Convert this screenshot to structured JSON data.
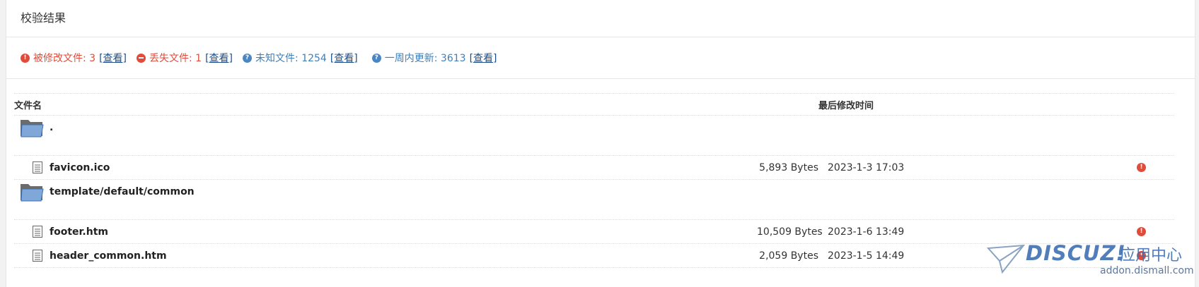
{
  "panel": {
    "title": "校验结果"
  },
  "summary": [
    {
      "label": "被修改文件: 3",
      "link": "[查看]",
      "tone": "red",
      "icon": "warning-icon"
    },
    {
      "label": "丢失文件: 1",
      "link": "[查看]",
      "tone": "red",
      "icon": "minus-circle-icon"
    },
    {
      "label": "未知文件: 1254",
      "link": "[查看]",
      "tone": "blue",
      "icon": "question-icon"
    },
    {
      "label": "一周内更新: 3613",
      "link": "[查看]",
      "tone": "blue",
      "icon": "question-icon"
    }
  ],
  "table": {
    "headers": {
      "name": "文件名",
      "modified": "最后修改时间"
    },
    "rows": [
      {
        "type": "dir",
        "name": "."
      },
      {
        "type": "file",
        "name": "favicon.ico",
        "size": "5,893 Bytes",
        "modified": "2023-1-3 17:03",
        "status": "modified"
      },
      {
        "type": "dir",
        "name": "template/default/common"
      },
      {
        "type": "file",
        "name": "footer.htm",
        "size": "10,509 Bytes",
        "modified": "2023-1-6 13:49",
        "status": "modified"
      },
      {
        "type": "file",
        "name": "header_common.htm",
        "size": "2,059 Bytes",
        "modified": "2023-1-5 14:49",
        "status": "modified"
      }
    ]
  },
  "watermark": {
    "brand": "DISCUZ!",
    "cn": "应用中心",
    "url": "addon.dismall.com"
  },
  "colors": {
    "alert_red": "#e04b3a",
    "info_blue": "#4b86c4",
    "link_blue": "#1d4f8c",
    "border": "#e6e6e6"
  }
}
